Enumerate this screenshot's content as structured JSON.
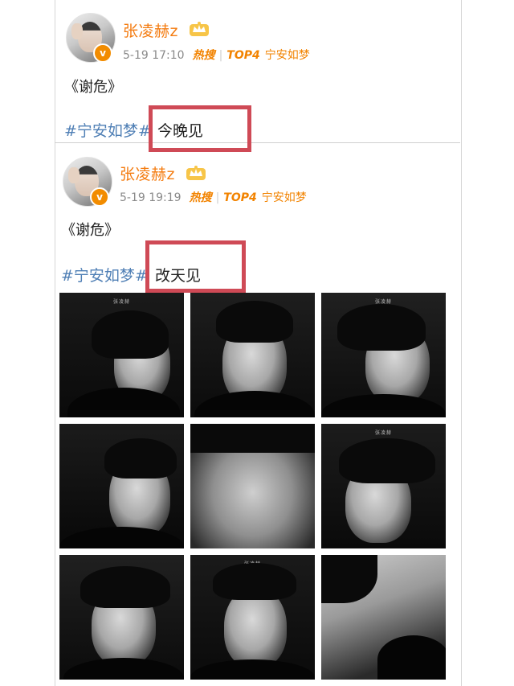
{
  "posts": [
    {
      "username": "张凌赫z",
      "time": "5-19 17:10",
      "hot_label": "热搜",
      "rank_label": "TOP4",
      "topic": "宁安如梦",
      "title": "《谢危》",
      "hashtag": "#宁安如梦#",
      "tail": "今晚见"
    },
    {
      "username": "张凌赫z",
      "time": "5-19 19:19",
      "hot_label": "热搜",
      "rank_label": "TOP4",
      "topic": "宁安如梦",
      "title": "《谢危》",
      "hashtag": "#宁安如梦#",
      "tail": "改天见"
    }
  ],
  "photo_tag": "张凌赫",
  "colors": {
    "username": "#f47b0f",
    "hashtag": "#4f7fb5",
    "hot": "#f28300",
    "highlight_box": "#cf4a56",
    "verified_badge": "#f28c00"
  },
  "icons": {
    "verified": "verified-badge-icon",
    "vip": "crown-icon"
  }
}
